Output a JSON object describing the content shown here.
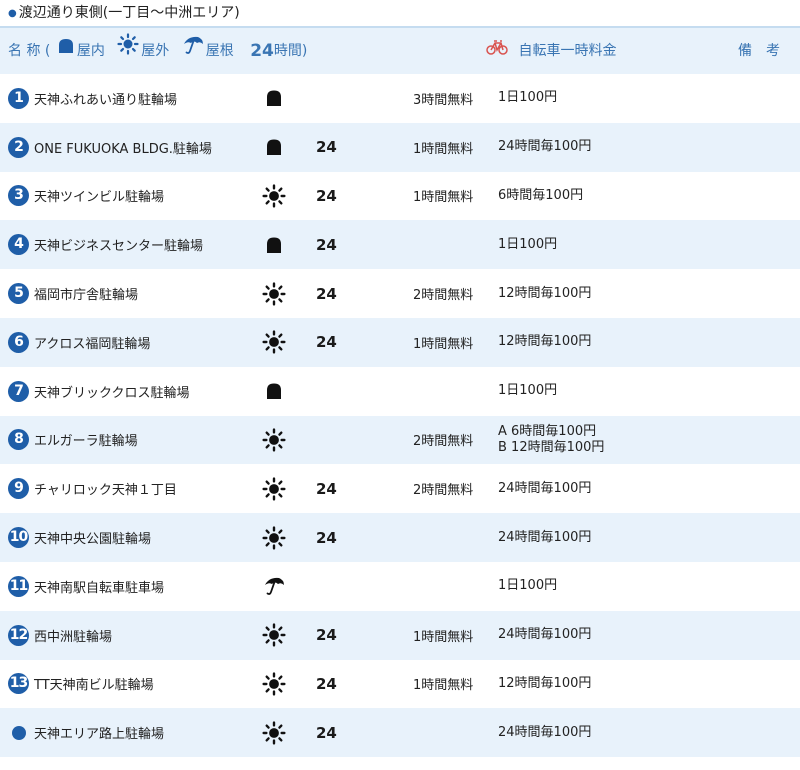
{
  "title": "渡辺通り東側(一丁目～中洲エリア)",
  "title_bullet": "●",
  "header": {
    "name_label": "名 称 (",
    "indoor_label": "屋内",
    "outdoor_label": "屋外",
    "roof_label": "屋根",
    "h24_label": "24",
    "h24_suffix": "時間)",
    "fee_label": "自転車一時料金",
    "note_label": "備　考"
  },
  "colors": {
    "accent": "#1f5ea8",
    "header_text": "#3a75b3",
    "row_alt_bg": "#e8f2fb",
    "bicycle_red": "#d9534f"
  },
  "rows": [
    {
      "num": "1",
      "name": "天神ふれあい通り駐輪場",
      "type": "indoor",
      "h24": "",
      "free": "3時間無料",
      "fee": [
        "1日100円"
      ],
      "note": ""
    },
    {
      "num": "2",
      "name": "ONE FUKUOKA BLDG.駐輪場",
      "type": "indoor",
      "h24": "24",
      "free": "1時間無料",
      "fee": [
        "24時間毎100円"
      ],
      "note": ""
    },
    {
      "num": "3",
      "name": "天神ツインビル駐輪場",
      "type": "outdoor",
      "h24": "24",
      "free": "1時間無料",
      "fee": [
        "6時間毎100円"
      ],
      "note": ""
    },
    {
      "num": "4",
      "name": "天神ビジネスセンター駐輪場",
      "type": "indoor",
      "h24": "24",
      "free": "",
      "fee": [
        "1日100円"
      ],
      "note": ""
    },
    {
      "num": "5",
      "name": "福岡市庁舎駐輪場",
      "type": "outdoor",
      "h24": "24",
      "free": "2時間無料",
      "fee": [
        "12時間毎100円"
      ],
      "note": ""
    },
    {
      "num": "6",
      "name": "アクロス福岡駐輪場",
      "type": "outdoor",
      "h24": "24",
      "free": "1時間無料",
      "fee": [
        "12時間毎100円"
      ],
      "note": ""
    },
    {
      "num": "7",
      "name": "天神ブリッククロス駐輪場",
      "type": "indoor",
      "h24": "",
      "free": "",
      "fee": [
        "1日100円"
      ],
      "note": ""
    },
    {
      "num": "8",
      "name": "エルガーラ駐輪場",
      "type": "outdoor",
      "h24": "",
      "free": "2時間無料",
      "fee": [
        "A 6時間毎100円",
        "B 12時間毎100円"
      ],
      "note": ""
    },
    {
      "num": "9",
      "name": "チャリロック天神１丁目",
      "type": "outdoor",
      "h24": "24",
      "free": "2時間無料",
      "fee": [
        "24時間毎100円"
      ],
      "note": ""
    },
    {
      "num": "10",
      "name": "天神中央公園駐輪場",
      "type": "outdoor",
      "h24": "24",
      "free": "",
      "fee": [
        "24時間毎100円"
      ],
      "note": ""
    },
    {
      "num": "11",
      "name": "天神南駅自転車駐車場",
      "type": "roof",
      "h24": "",
      "free": "",
      "fee": [
        "1日100円"
      ],
      "note": ""
    },
    {
      "num": "12",
      "name": "西中洲駐輪場",
      "type": "outdoor",
      "h24": "24",
      "free": "1時間無料",
      "fee": [
        "24時間毎100円"
      ],
      "note": ""
    },
    {
      "num": "13",
      "name": "TT天神南ビル駐輪場",
      "type": "outdoor",
      "h24": "24",
      "free": "1時間無料",
      "fee": [
        "12時間毎100円"
      ],
      "note": ""
    },
    {
      "num": "",
      "name": "天神エリア路上駐輪場",
      "type": "outdoor",
      "h24": "24",
      "free": "",
      "fee": [
        "24時間毎100円"
      ],
      "note": ""
    }
  ]
}
